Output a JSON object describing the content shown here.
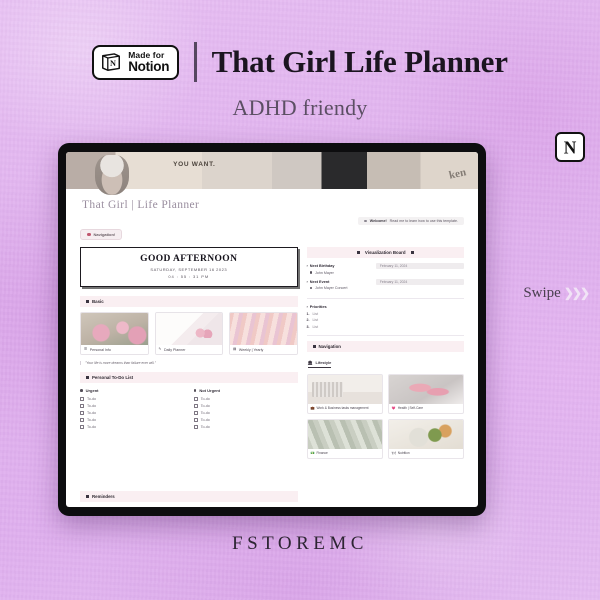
{
  "background_color": "#e2b6ef",
  "header": {
    "badge": {
      "made_for": "Made for",
      "notion": "Notion",
      "icon": "notion-cube-icon"
    },
    "title": "That Girl Life Planner",
    "subtitle": "ADHD friendy"
  },
  "tablet": {
    "cover": {
      "word": "YOU WANT.",
      "word2": "ken"
    },
    "page_title": "That Girl | Life Planner",
    "welcome_callout": {
      "bold": "Welcome!",
      "text": "Read me to learn how to use this template."
    },
    "nav_pill": "Navigation!",
    "greeting": {
      "title": "GOOD AFTERNOON",
      "date": "SATURDAY, SEPTEMBER 16 2023",
      "time": "04 : 55 : 31 PM"
    },
    "basic": {
      "heading": "Basic",
      "cards": [
        {
          "label": "Personal Info",
          "icon": "person-icon"
        },
        {
          "label": "Daily Planner",
          "icon": "planner-icon"
        },
        {
          "label": "Weekly | Yearly",
          "icon": "calendar-icon"
        }
      ],
      "quote": "\"Your life is more dreams than failure ever will.\""
    },
    "todo": {
      "heading": "Personal To-Do List",
      "columns": [
        {
          "title": "Urgent",
          "items": [
            "To-do",
            "To-do",
            "To-do",
            "To-do",
            "To-do"
          ]
        },
        {
          "title": "Not Urgent",
          "items": [
            "To-do",
            "To-do",
            "To-do",
            "To-do",
            "To-do"
          ]
        }
      ]
    },
    "reminders": {
      "heading": "Reminders"
    },
    "visualization": {
      "heading": "Visualization Board",
      "rows": [
        {
          "key": "Next Birthday",
          "value": "February 11, 2024",
          "sub": "John Mayer"
        },
        {
          "key": "Next Event",
          "value": "February 11, 2024",
          "sub": "John Mayer Concert"
        }
      ],
      "priorities_title": "Priorities",
      "priorities": [
        {
          "num": "1.",
          "text": "List"
        },
        {
          "num": "2.",
          "text": "List"
        },
        {
          "num": "3.",
          "text": "List"
        }
      ]
    },
    "navigation": {
      "heading": "Navigation",
      "tab": "Lifestyle",
      "tab_icon": "building-icon",
      "cards": [
        {
          "label": "Work & Business tasks management",
          "icon": "briefcase-icon"
        },
        {
          "label": "Health | Self-Care",
          "icon": "heart-icon"
        },
        {
          "label": "Finance",
          "icon": "money-icon"
        },
        {
          "label": "Nutrition",
          "icon": "food-icon"
        }
      ]
    }
  },
  "corner_logo": {
    "icon": "notion-n-icon",
    "letter": "N"
  },
  "swipe": {
    "text": "Swipe",
    "arrows": "❯❯❯"
  },
  "brand": "FSTOREMC"
}
